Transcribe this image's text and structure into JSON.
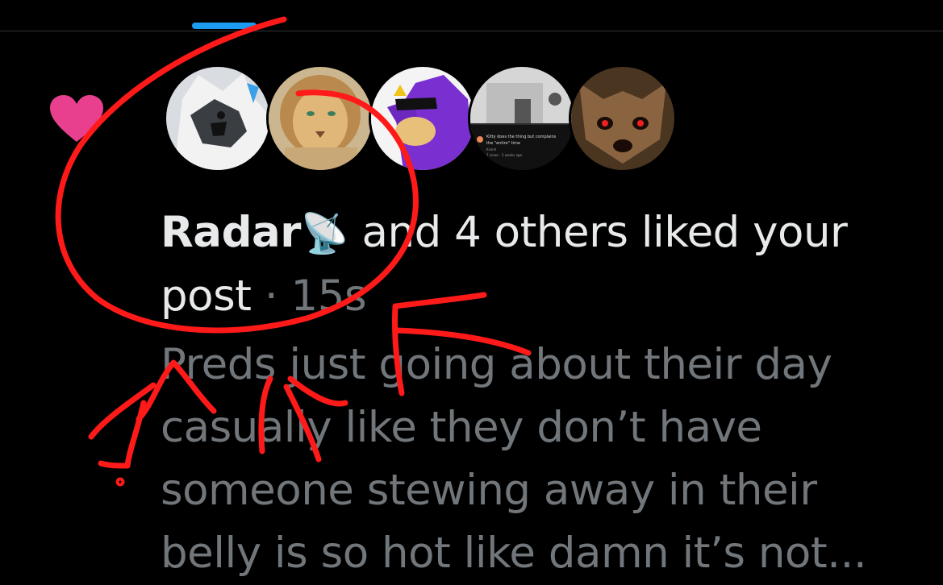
{
  "notification": {
    "actor_name": "Radar",
    "actor_emoji": "📡",
    "action_text": " and 4 others liked your post",
    "separator": " · ",
    "time": "15s",
    "preview_lines": [
      "Preds just going about their day",
      "casually like they don’t have",
      "someone stewing away in their",
      "belly is so hot like damn it’s not..."
    ],
    "avatars": [
      {
        "name": "avatar-white-wolf"
      },
      {
        "name": "avatar-lion"
      },
      {
        "name": "avatar-purple-hedgehog"
      },
      {
        "name": "avatar-video-thumbnail",
        "caption_1": "Kitty does the thing but complains",
        "caption_2": "the \"entire\" time",
        "caption_3": "Ksenh",
        "caption_4": "7 views · 3 weeks ago"
      },
      {
        "name": "avatar-brown-wolf"
      }
    ]
  },
  "icons": {
    "like": "heart-icon"
  },
  "colors": {
    "background": "#000000",
    "heart": "#f91880",
    "accent": "#1d9bf0",
    "text_primary": "#e7e9ea",
    "text_secondary": "#71767b",
    "scribble": "#ff0000"
  }
}
